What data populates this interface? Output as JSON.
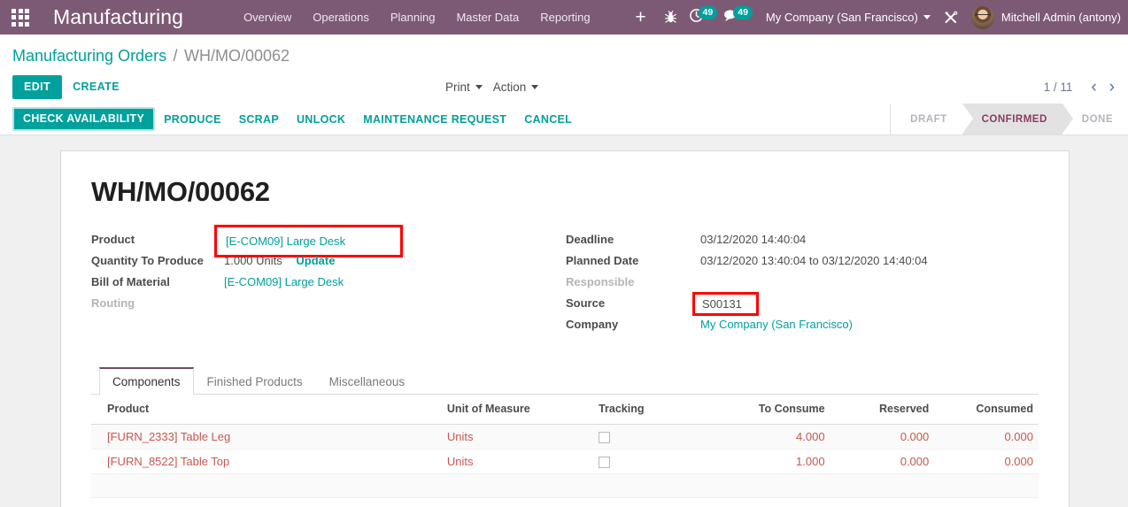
{
  "navbar": {
    "apps_icon": "apps-grid-icon",
    "brand": "Manufacturing",
    "menu": [
      {
        "label": "Overview"
      },
      {
        "label": "Operations"
      },
      {
        "label": "Planning"
      },
      {
        "label": "Master Data"
      },
      {
        "label": "Reporting"
      }
    ],
    "plus_label": "+",
    "debug_icon": "bug-icon",
    "activities_icon": "clock-icon",
    "activities_count": "49",
    "messages_icon": "chat-bubble-icon",
    "messages_count": "49",
    "company": "My Company (San Francisco)",
    "tools_icon": "crossed-tools-icon",
    "avatar_icon": "user-avatar",
    "user": "Mitchell Admin (antony)",
    "bg_color": "#7C5A75",
    "badge_color": "#00A09D"
  },
  "breadcrumb": {
    "root": "Manufacturing Orders",
    "separator": "/",
    "current": "WH/MO/00062"
  },
  "controls": {
    "edit_label": "EDIT",
    "create_label": "CREATE",
    "print_label": "Print",
    "action_label": "Action",
    "pager_count": "1 / 11",
    "prev_icon": "chevron-left-icon",
    "next_icon": "chevron-right-icon",
    "prev_glyph": "‹",
    "next_glyph": "›",
    "accent_color": "#00A09D"
  },
  "action_bar": {
    "buttons": [
      {
        "label": "CHECK AVAILABILITY",
        "primary": true
      },
      {
        "label": "PRODUCE",
        "primary": false
      },
      {
        "label": "SCRAP",
        "primary": false
      },
      {
        "label": "UNLOCK",
        "primary": false
      },
      {
        "label": "MAINTENANCE REQUEST",
        "primary": false
      },
      {
        "label": "CANCEL",
        "primary": false
      }
    ],
    "statuses": [
      {
        "label": "DRAFT",
        "active": false
      },
      {
        "label": "CONFIRMED",
        "active": true
      },
      {
        "label": "DONE",
        "active": false
      }
    ],
    "active_status_color": "#8B3A62"
  },
  "form": {
    "title": "WH/MO/00062",
    "left": {
      "product_label": "Product",
      "product_value": "[E-COM09] Large Desk",
      "qty_label": "Quantity To Produce",
      "qty_value": "1.000 Units",
      "qty_update_link": "Update",
      "bom_label": "Bill of Material",
      "bom_value": "[E-COM09] Large Desk",
      "routing_label": "Routing",
      "routing_value": ""
    },
    "right": {
      "deadline_label": "Deadline",
      "deadline_value": "03/12/2020 14:40:04",
      "planned_label": "Planned Date",
      "planned_value": "03/12/2020 13:40:04  to  03/12/2020 14:40:04",
      "responsible_label": "Responsible",
      "responsible_value": "",
      "source_label": "Source",
      "source_value": "S00131",
      "company_label": "Company",
      "company_value": "My Company (San Francisco)"
    },
    "highlight_color": "#ff0000"
  },
  "notebook": {
    "tabs": [
      {
        "label": "Components",
        "active": true
      },
      {
        "label": "Finished Products",
        "active": false
      },
      {
        "label": "Miscellaneous",
        "active": false
      }
    ]
  },
  "table": {
    "headers": [
      "Product",
      "Unit of Measure",
      "Tracking",
      "To Consume",
      "Reserved",
      "Consumed"
    ],
    "rows": [
      {
        "product": "[FURN_2333] Table Leg",
        "uom": "Units",
        "tracking_icon": "checkbox-unchecked-icon",
        "to_consume": "4.000",
        "reserved": "0.000",
        "consumed": "0.000"
      },
      {
        "product": "[FURN_8522] Table Top",
        "uom": "Units",
        "tracking_icon": "checkbox-unchecked-icon",
        "to_consume": "1.000",
        "reserved": "0.000",
        "consumed": "0.000"
      }
    ],
    "row_text_color": "#c9564e"
  }
}
